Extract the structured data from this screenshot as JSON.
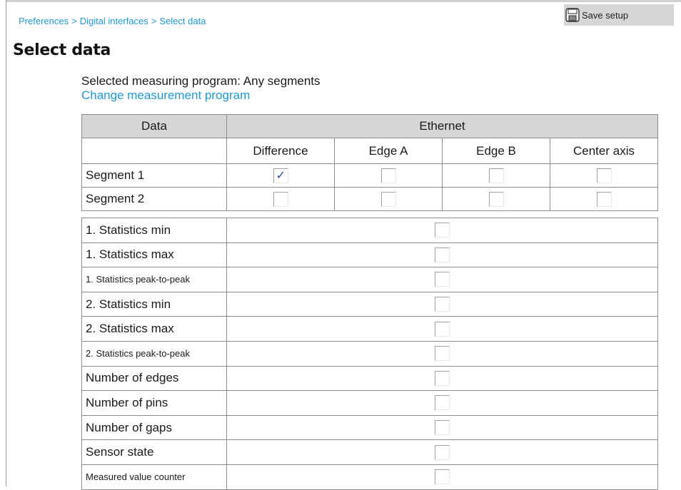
{
  "breadcrumb": {
    "items": [
      "Preferences",
      "Digital interfaces",
      "Select data"
    ],
    "separator": ">"
  },
  "toolbar": {
    "save_label": "Save setup",
    "save_icon": "floppy-disk-icon"
  },
  "page": {
    "title": "Select data",
    "program_info": "Selected measuring program: Any segments",
    "change_link": "Change measurement program"
  },
  "segments_table": {
    "header_data": "Data",
    "header_group": "Ethernet",
    "columns": [
      "Difference",
      "Edge A",
      "Edge B",
      "Center axis"
    ],
    "rows": [
      {
        "label": "Segment 1",
        "checked": [
          true,
          false,
          false,
          false
        ]
      },
      {
        "label": "Segment 2",
        "checked": [
          false,
          false,
          false,
          false
        ]
      }
    ]
  },
  "stats_table": {
    "rows": [
      {
        "label": "1. Statistics min",
        "checked": false
      },
      {
        "label": "1. Statistics max",
        "checked": false
      },
      {
        "label": "1. Statistics peak-to-peak",
        "checked": false
      },
      {
        "label": "2. Statistics min",
        "checked": false
      },
      {
        "label": "2. Statistics max",
        "checked": false
      },
      {
        "label": "2. Statistics peak-to-peak",
        "checked": false
      },
      {
        "label": "Number of edges",
        "checked": false
      },
      {
        "label": "Number of pins",
        "checked": false
      },
      {
        "label": "Number of gaps",
        "checked": false
      },
      {
        "label": "Sensor state",
        "checked": false
      },
      {
        "label": "Measured value counter",
        "checked": false
      }
    ]
  },
  "colors": {
    "link": "#1e9ad6",
    "header_bg": "#d6d6d6",
    "check": "#1f4aa8"
  }
}
